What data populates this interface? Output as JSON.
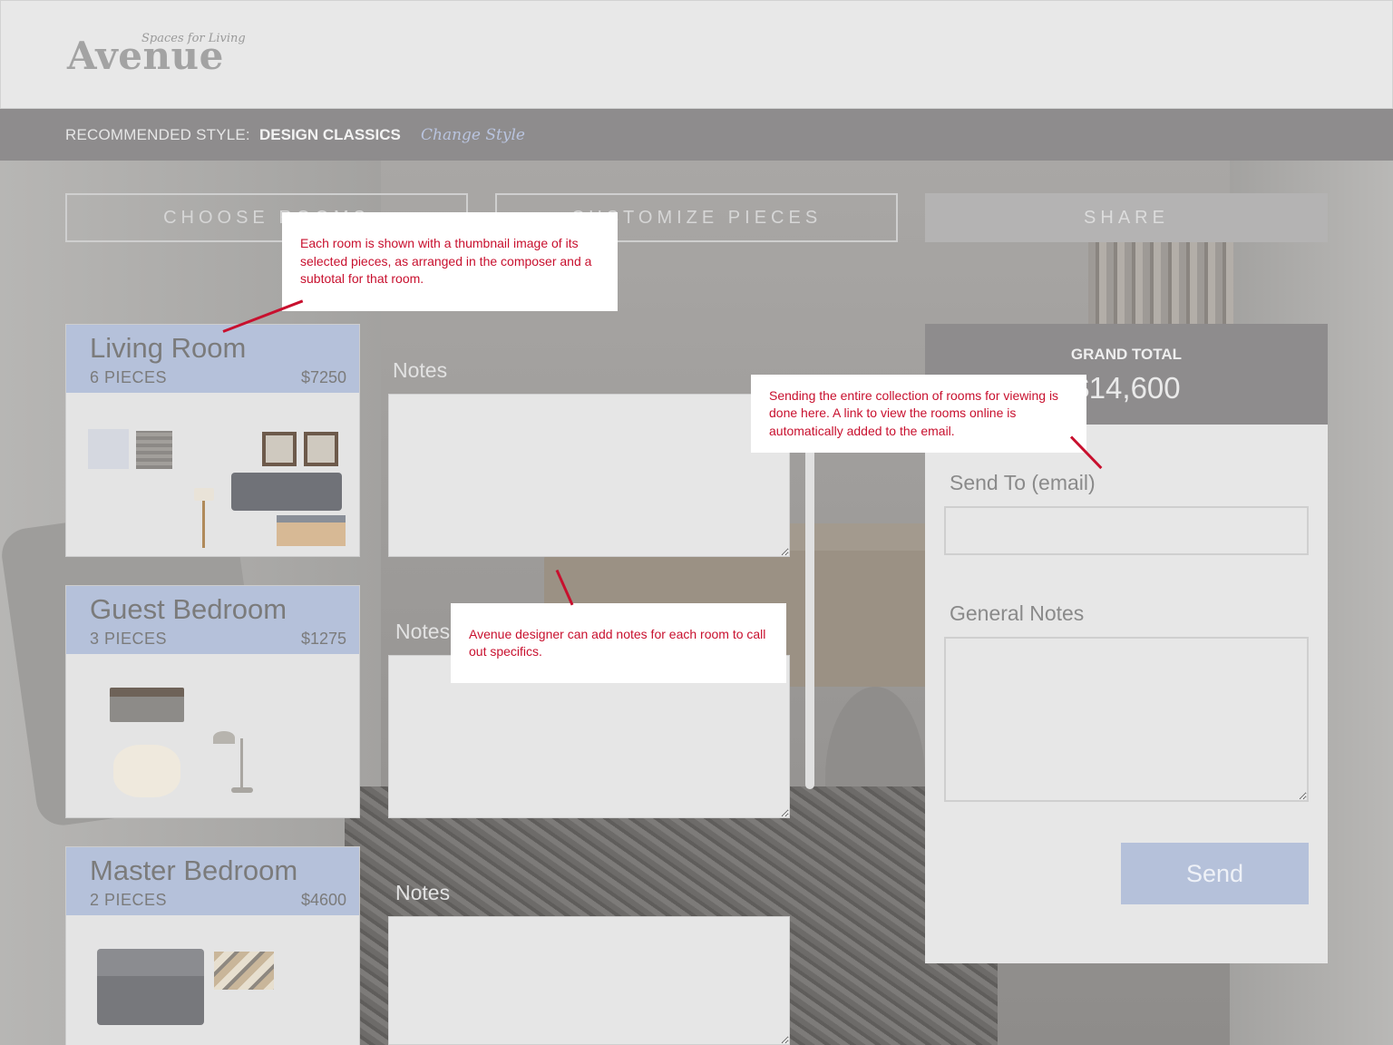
{
  "brand": {
    "tagline": "Spaces for Living",
    "name": "Avenue"
  },
  "style_bar": {
    "label": "RECOMMENDED STYLE:",
    "value": "DESIGN CLASSICS",
    "change_link": "Change Style"
  },
  "steps": {
    "choose": "CHOOSE ROOMS",
    "customize": "CUSTOMIZE PIECES",
    "share": "SHARE"
  },
  "rooms": [
    {
      "name": "Living Room",
      "pieces": "6 PIECES",
      "subtotal": "$7250",
      "notes_label": "Notes"
    },
    {
      "name": "Guest Bedroom",
      "pieces": "3 PIECES",
      "subtotal": "$1275",
      "notes_label": "Notes"
    },
    {
      "name": "Master Bedroom",
      "pieces": "2 PIECES",
      "subtotal": "$4600",
      "notes_label": "Notes"
    }
  ],
  "share_panel": {
    "grand_total_label": "GRAND TOTAL",
    "grand_total_value": "$14,600",
    "send_to_label": "Send To (email)",
    "general_notes_label": "General Notes",
    "send_button": "Send"
  },
  "annotations": {
    "rooms": "Each room is shown with a thumbnail image of its selected pieces, as arranged in the composer and a subtotal for that room.",
    "notes": "Avenue designer can add notes for each room to call out specifics.",
    "send": "Sending the entire collection of rooms for viewing is done here. A link to view the rooms online is automatically added to the email."
  },
  "colors": {
    "accent_blue": "#b5c1da",
    "annotation_red": "#c8102e",
    "bar_gray": "#8e8c8d"
  }
}
